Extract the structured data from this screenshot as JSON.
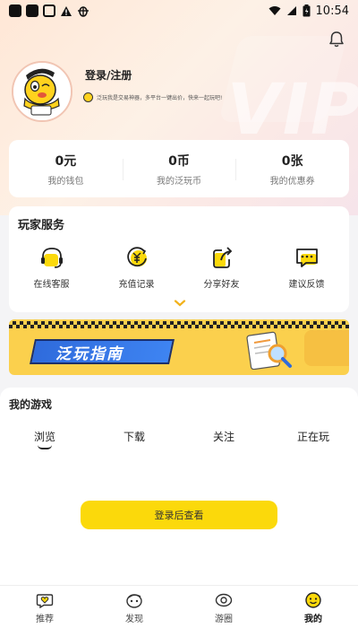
{
  "status_bar": {
    "time": "10:54"
  },
  "profile": {
    "login_label": "登录/注册",
    "description": "泛玩我是交易神器，多平台一键出价，快来一起玩吧!"
  },
  "header": {
    "watermark": "VIP"
  },
  "wallet": {
    "items": [
      {
        "value": "0元",
        "label": "我的钱包"
      },
      {
        "value": "0币",
        "label": "我的泛玩币"
      },
      {
        "value": "0张",
        "label": "我的优惠券"
      }
    ]
  },
  "services": {
    "title": "玩家服务",
    "items": [
      {
        "label": "在线客服",
        "icon": "headset-icon"
      },
      {
        "label": "充值记录",
        "icon": "yuan-recharge-icon"
      },
      {
        "label": "分享好友",
        "icon": "share-icon"
      },
      {
        "label": "建议反馈",
        "icon": "feedback-icon"
      }
    ]
  },
  "banner": {
    "title": "泛玩指南"
  },
  "games": {
    "title": "我的游戏",
    "tabs": [
      "浏览",
      "下载",
      "关注",
      "正在玩"
    ],
    "active_tab": "浏览",
    "login_button": "登录后查看"
  },
  "bottom_nav": {
    "items": [
      {
        "label": "推荐",
        "icon": "heart-chat-icon"
      },
      {
        "label": "发现",
        "icon": "discover-face-icon"
      },
      {
        "label": "游圈",
        "icon": "eye-circle-icon"
      },
      {
        "label": "我的",
        "icon": "smiley-face-icon",
        "active": true
      }
    ]
  },
  "colors": {
    "accent_yellow": "#fbd90b",
    "banner_blue": "#2f6bdc"
  }
}
